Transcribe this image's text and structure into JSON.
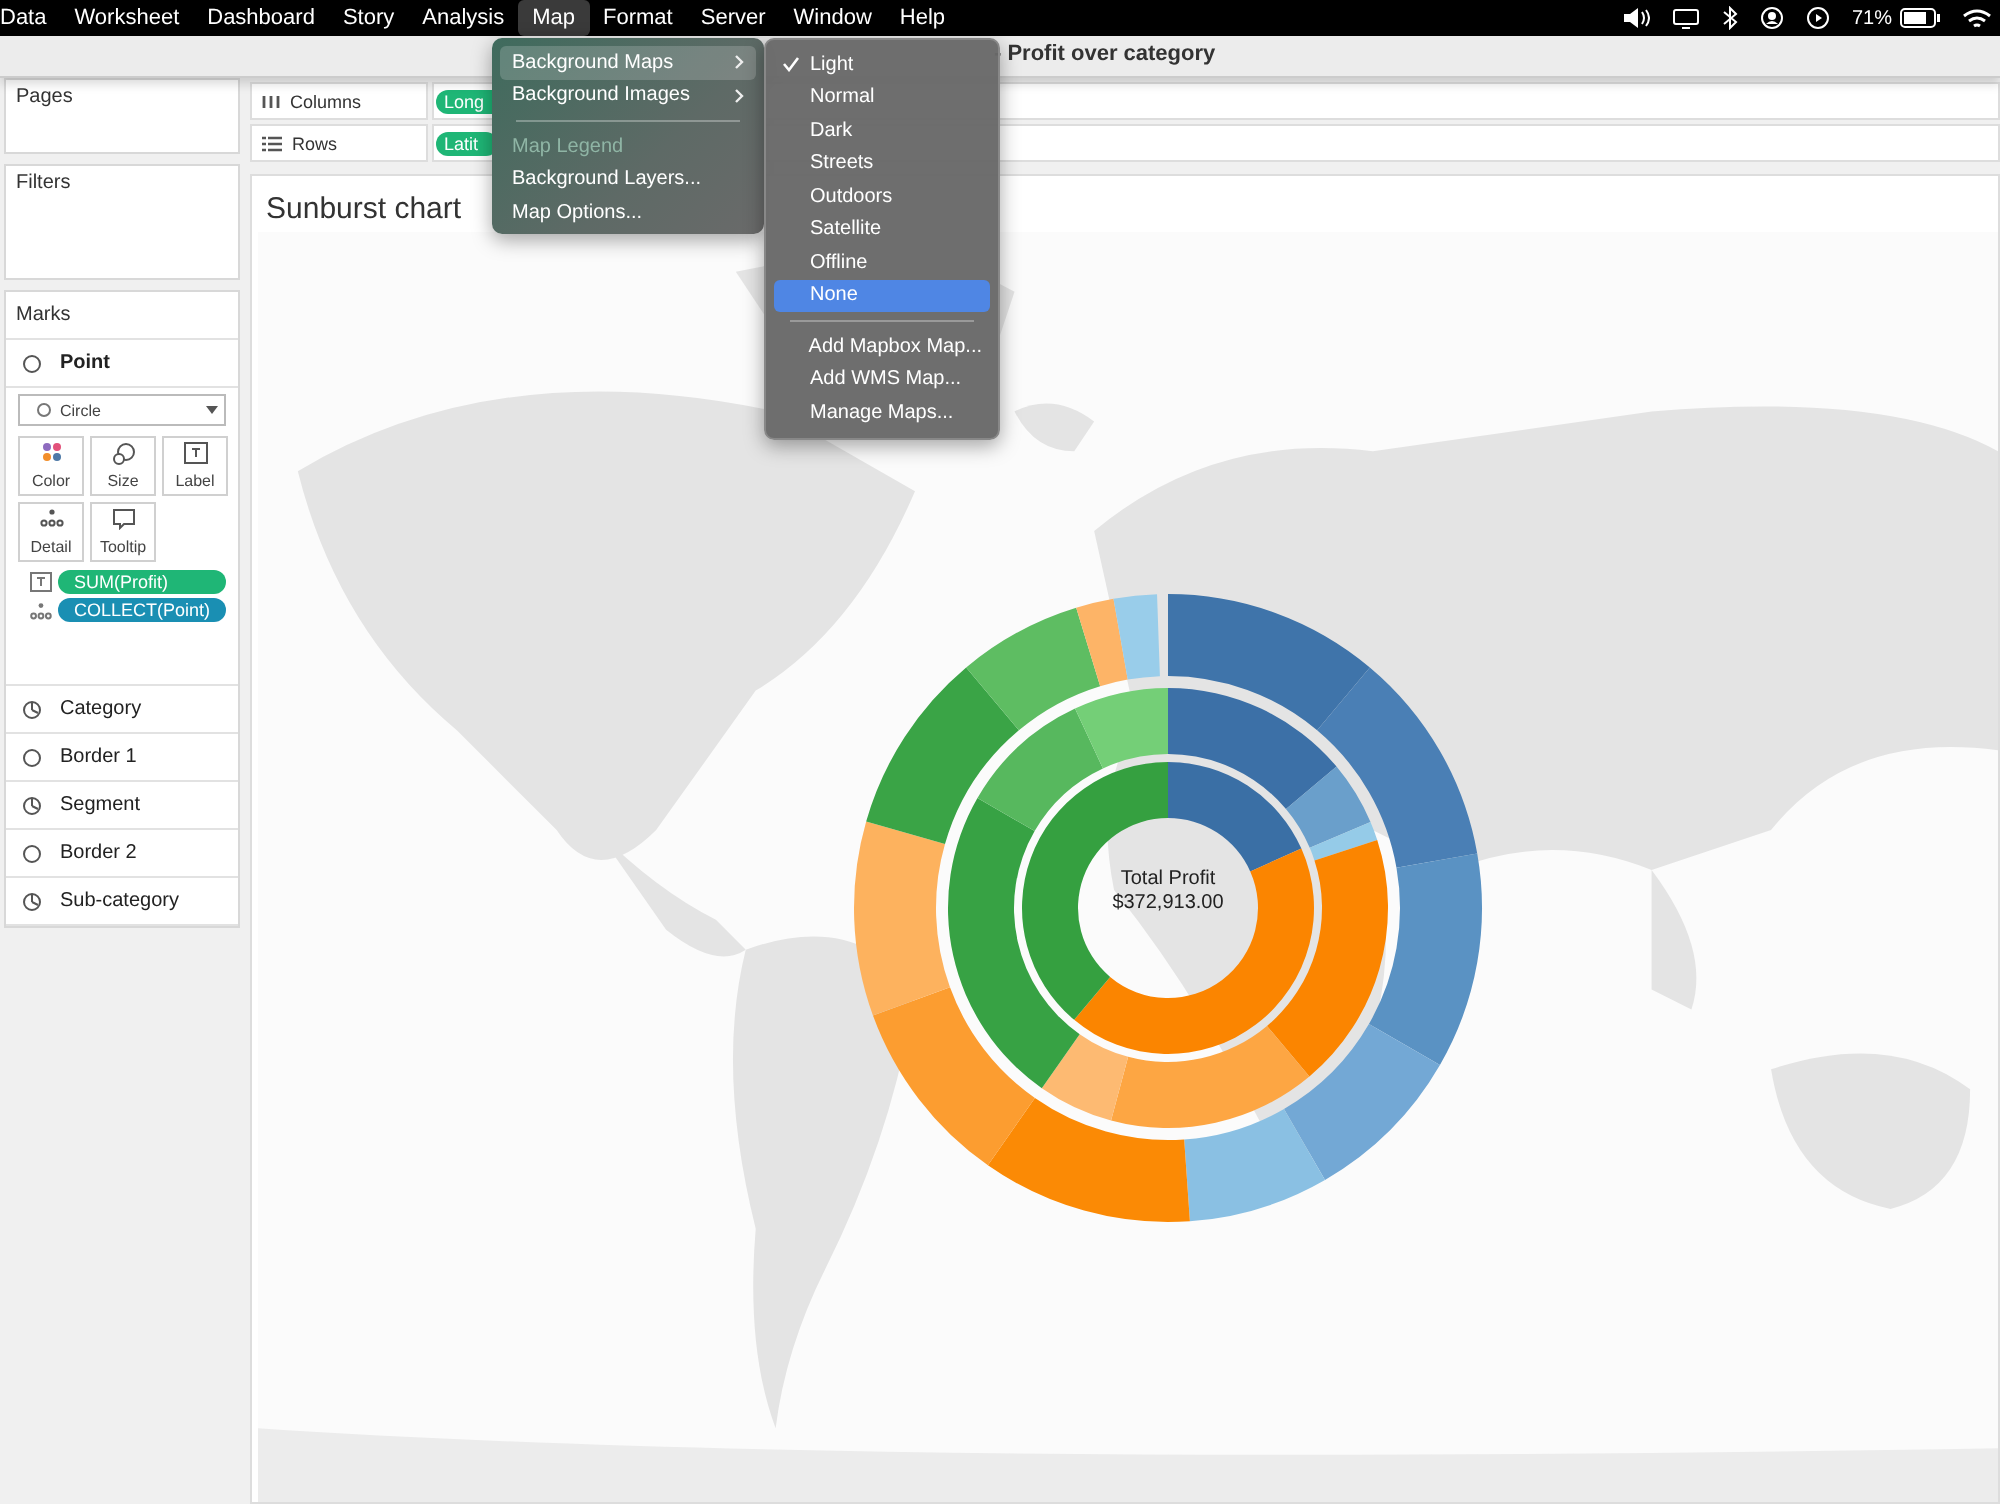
{
  "menu_bar": {
    "items": [
      {
        "label": "Data",
        "selected": false
      },
      {
        "label": "Worksheet",
        "selected": false
      },
      {
        "label": "Dashboard",
        "selected": false
      },
      {
        "label": "Story",
        "selected": false
      },
      {
        "label": "Analysis",
        "selected": false
      },
      {
        "label": "Map",
        "selected": true
      },
      {
        "label": "Format",
        "selected": false
      },
      {
        "label": "Server",
        "selected": false
      },
      {
        "label": "Window",
        "selected": false
      },
      {
        "label": "Help",
        "selected": false
      }
    ],
    "battery_percent": "71%"
  },
  "title_bar": {
    "title": "- Profit over category"
  },
  "left_panel": {
    "pages": {
      "label": "Pages"
    },
    "filters": {
      "label": "Filters"
    },
    "marks": {
      "label": "Marks",
      "mark_type": {
        "label": "Point"
      },
      "shape_dropdown": {
        "value": "Circle"
      },
      "buttons": [
        {
          "label": "Color",
          "kind": "color"
        },
        {
          "label": "Size",
          "kind": "size"
        },
        {
          "label": "Label",
          "kind": "label"
        },
        {
          "label": "Detail",
          "kind": "detail"
        },
        {
          "label": "Tooltip",
          "kind": "tooltip"
        }
      ],
      "pills": [
        {
          "label": "SUM(Profit)",
          "kind": "label",
          "color": "#1fb676"
        },
        {
          "label": "COLLECT(Point)",
          "kind": "detail",
          "color": "#1a8fb3"
        }
      ],
      "layers": [
        {
          "label": "Category",
          "kind": "pie"
        },
        {
          "label": "Border 1",
          "kind": "circle"
        },
        {
          "label": "Segment",
          "kind": "pie"
        },
        {
          "label": "Border 2",
          "kind": "circle"
        },
        {
          "label": "Sub-category",
          "kind": "pie"
        }
      ]
    }
  },
  "shelves": [
    {
      "label": "Columns",
      "kind": "columns",
      "pill": "Long"
    },
    {
      "label": "Rows",
      "kind": "rows",
      "pill": "Latit"
    }
  ],
  "sheet": {
    "title": "Sunburst chart",
    "chart_center": {
      "title": "Total Profit",
      "value": "$372,913.00"
    }
  },
  "menu": {
    "items": [
      {
        "label": "Background Maps",
        "kind": "submenu",
        "selected": true,
        "disabled": false
      },
      {
        "label": "Background Images",
        "kind": "submenu",
        "selected": false,
        "disabled": false
      },
      {
        "kind": "separator"
      },
      {
        "label": "Map Legend",
        "kind": "item",
        "selected": false,
        "disabled": true
      },
      {
        "label": "Background Layers...",
        "kind": "item",
        "selected": false,
        "disabled": false
      },
      {
        "label": "Map Options...",
        "kind": "item",
        "selected": false,
        "disabled": false
      }
    ]
  },
  "submenu": {
    "items": [
      {
        "label": "Light",
        "kind": "item",
        "checked": true,
        "selected": false
      },
      {
        "label": "Normal",
        "kind": "item",
        "checked": false,
        "selected": false
      },
      {
        "label": "Dark",
        "kind": "item",
        "checked": false,
        "selected": false
      },
      {
        "label": "Streets",
        "kind": "item",
        "checked": false,
        "selected": false
      },
      {
        "label": "Outdoors",
        "kind": "item",
        "checked": false,
        "selected": false
      },
      {
        "label": "Satellite",
        "kind": "item",
        "checked": false,
        "selected": false
      },
      {
        "label": "Offline",
        "kind": "item",
        "checked": false,
        "selected": false
      },
      {
        "label": "None",
        "kind": "item",
        "checked": false,
        "selected": true
      },
      {
        "kind": "separator"
      },
      {
        "label": "Add Mapbox Map...",
        "kind": "item",
        "checked": false,
        "selected": false
      },
      {
        "label": "Add WMS Map...",
        "kind": "item",
        "checked": false,
        "selected": false
      },
      {
        "label": "Manage Maps...",
        "kind": "item",
        "checked": false,
        "selected": false
      }
    ]
  }
}
